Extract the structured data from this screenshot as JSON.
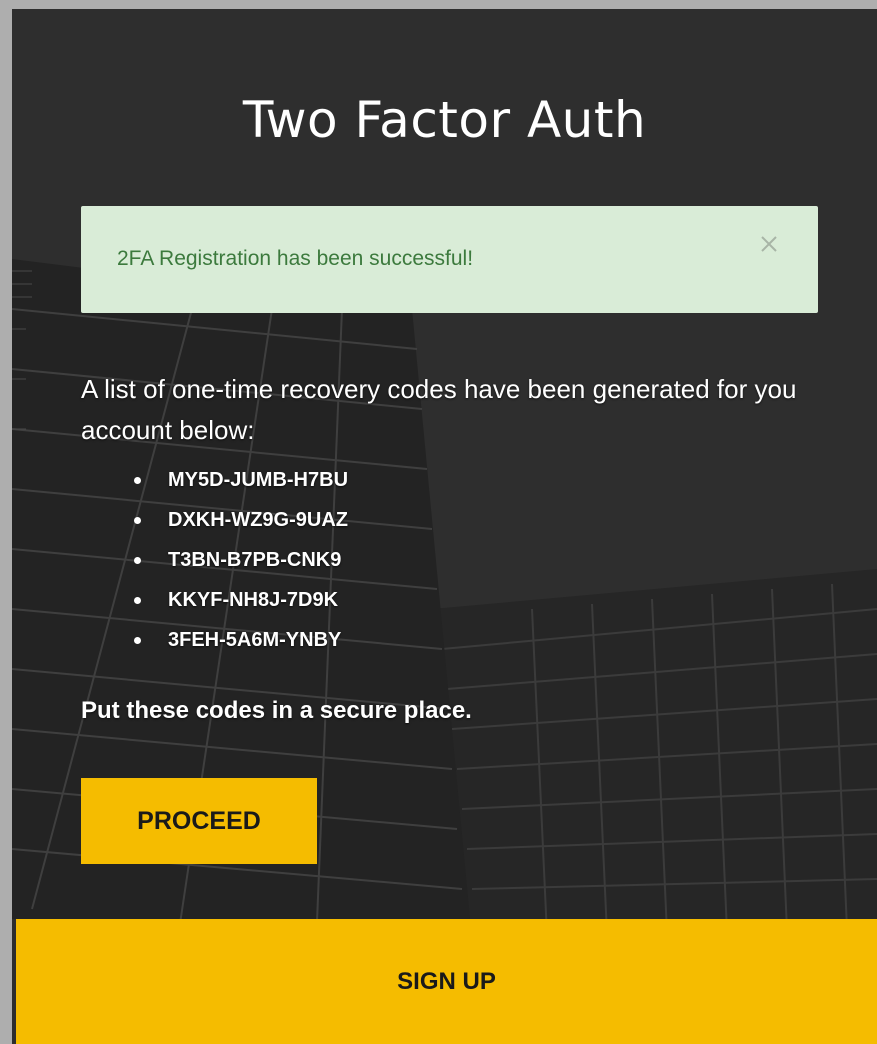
{
  "page": {
    "title": "Two Factor Auth"
  },
  "alert": {
    "message": "2FA Registration has been successful!",
    "close_icon": "close-icon",
    "background": "#d9ecd7",
    "text_color": "#3c7a3d"
  },
  "recovery": {
    "description": "A list of one-time recovery codes have been generated for you account below:",
    "codes": [
      "MY5D-JUMB-H7BU",
      "DXKH-WZ9G-9UAZ",
      "T3BN-B7PB-CNK9",
      "KKYF-NH8J-7D9K",
      "3FEH-5A6M-YNBY"
    ],
    "note": "Put these codes in a secure place."
  },
  "actions": {
    "proceed_label": "PROCEED",
    "signup_label": "SIGN UP",
    "accent": "#f5bc00"
  }
}
